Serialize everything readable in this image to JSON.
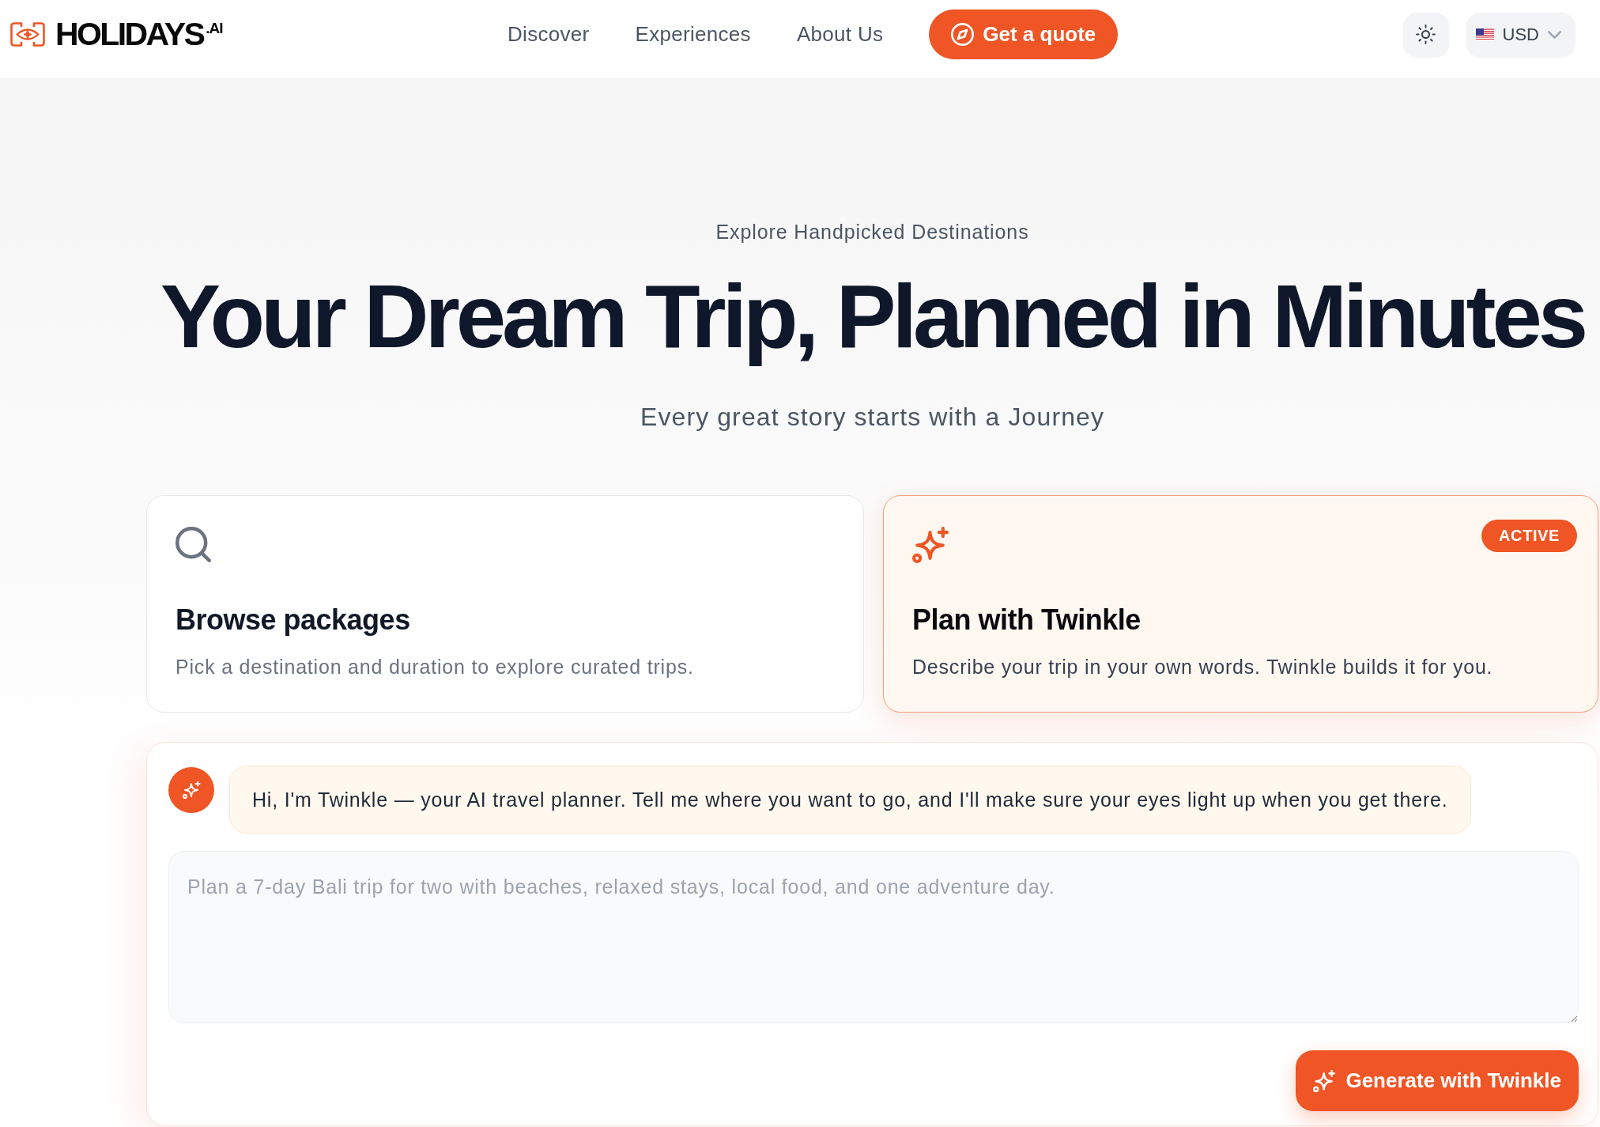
{
  "header": {
    "logo": "HOLIDAYS$^{.AI}$",
    "nav": [
      "Discover",
      "Experiences",
      "About Us"
    ],
    "cta": "Get a quote",
    "currency": "USD"
  },
  "hero": {
    "eyebrow": "Explore Handpicked Destinations",
    "title": "Your Dream Trip, Planned in Minutes",
    "subtitle": "Every great story starts with a Journey"
  },
  "modes": [
    {
      "kind": "browse",
      "title": "Browse packages",
      "description": "Pick a destination and duration to explore curated trips.",
      "selected": false
    },
    {
      "kind": "plan",
      "title": "Plan with Twinkle",
      "description": "Describe your trip in your own words. Twinkle builds it for you.",
      "selected": true,
      "badge": "ACTIVE"
    }
  ],
  "chat": {
    "message": "Hi, I'm Twinkle — your AI travel planner. Tell me where you want to go, and I'll make sure your eyes light up when you get there.",
    "prompt": {
      "placeholder": "Plan a 7-day Bali trip for two with beaches, relaxed stays, local food, and one adventure day."
    },
    "submit": "Generate with Twinkle"
  }
}
